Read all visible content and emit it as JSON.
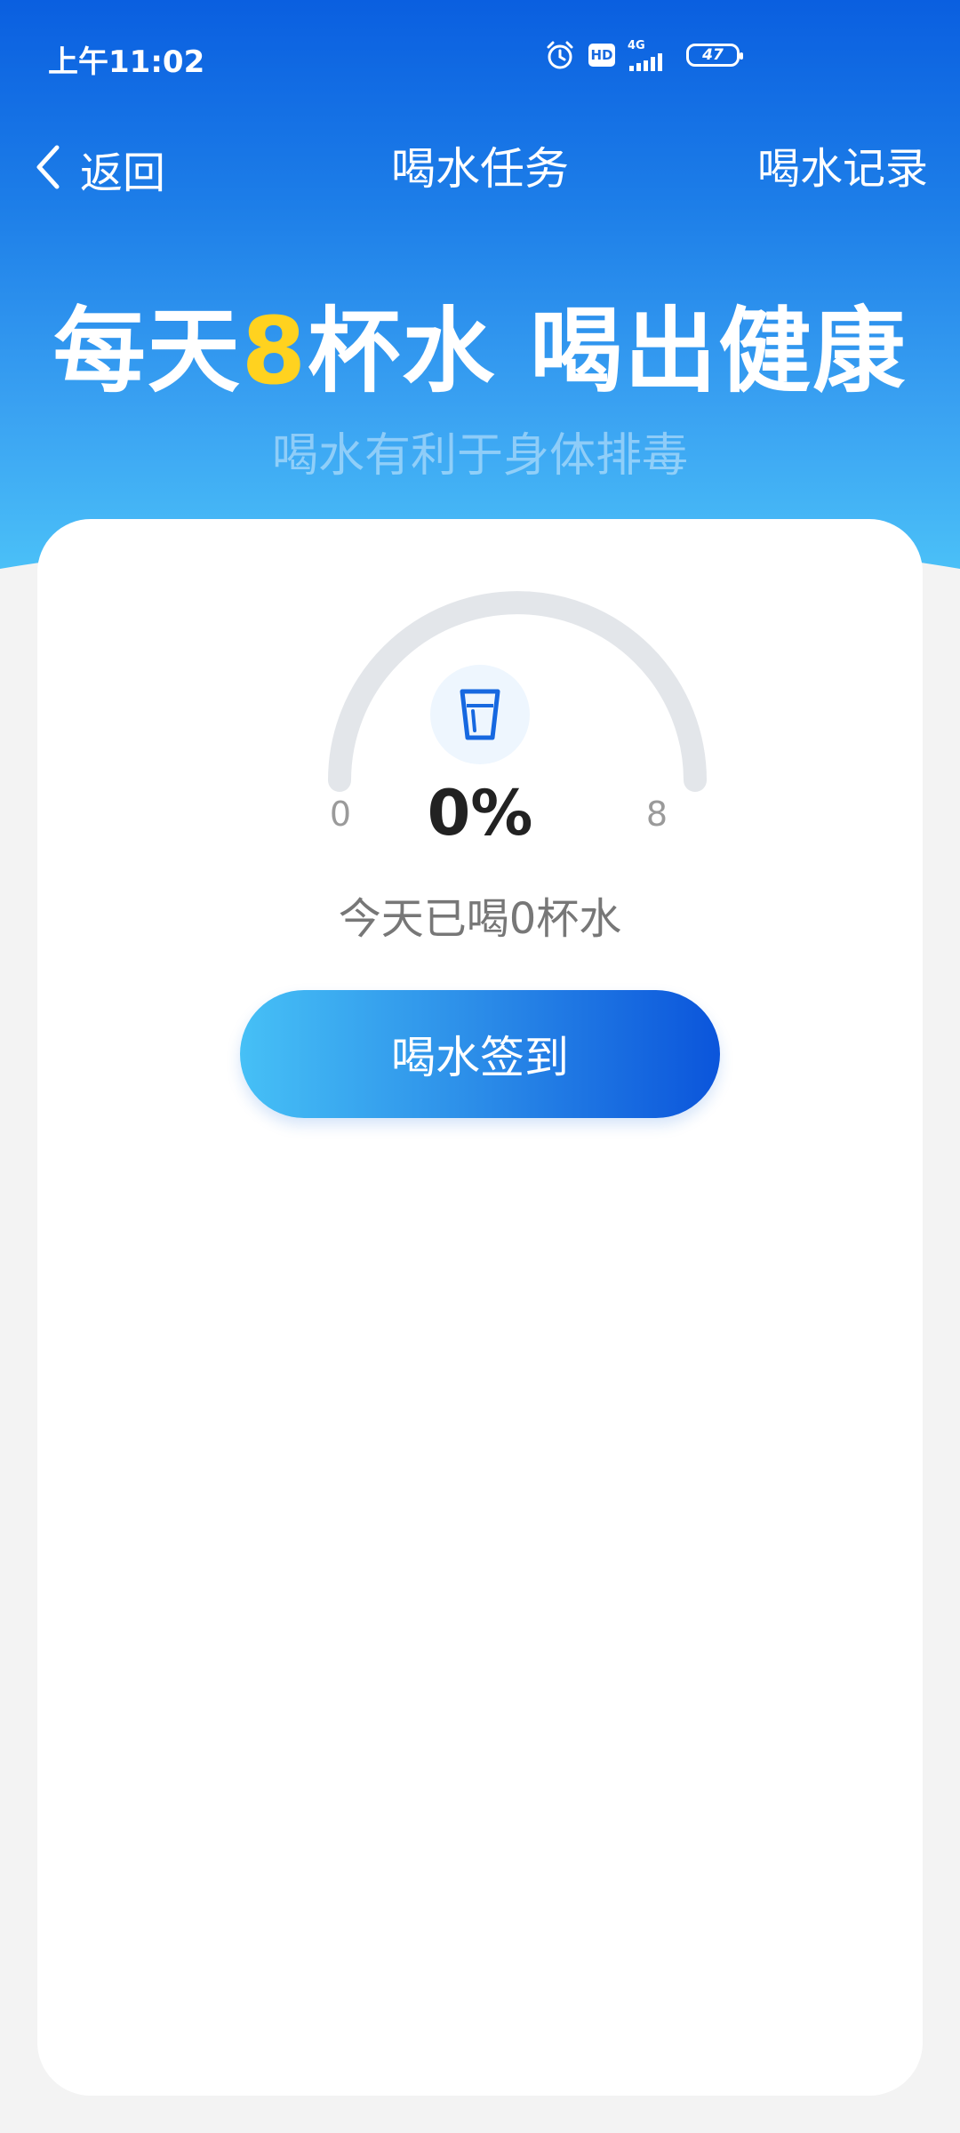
{
  "status_bar": {
    "time": "上午11:02",
    "hd": "HD",
    "network": "4G",
    "battery": "47"
  },
  "nav": {
    "back_label": "返回",
    "title": "喝水任务",
    "record_label": "喝水记录"
  },
  "hero": {
    "slogan_prefix": "每天",
    "slogan_highlight": "8",
    "slogan_suffix": "杯水 喝出健康",
    "subtitle": "喝水有利于身体排毒"
  },
  "progress": {
    "min": "0",
    "max": "8",
    "percent_text": "0%",
    "fraction": 0.0,
    "today_text": "今天已喝0杯水"
  },
  "actions": {
    "checkin_label": "喝水签到"
  },
  "colors": {
    "accent": "#1668e0",
    "highlight": "#ffd21f",
    "track": "#e3e6ea"
  },
  "icons": {
    "back": "chevron-left-icon",
    "alarm": "alarm-clock-icon",
    "signal": "signal-bars-icon",
    "cup": "water-cup-icon"
  }
}
